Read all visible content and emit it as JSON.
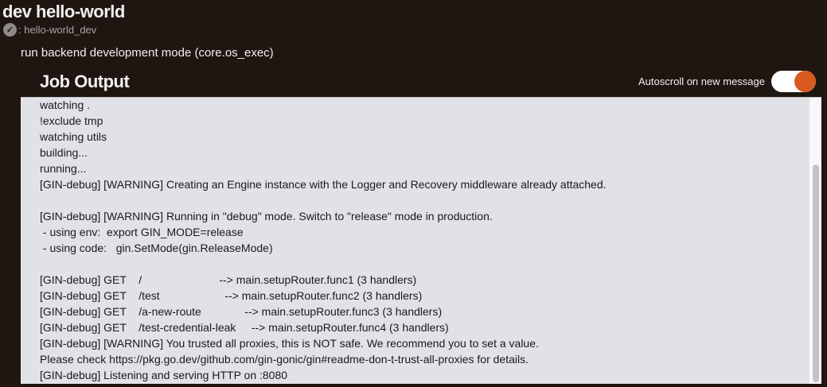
{
  "header": {
    "title": "dev hello-world",
    "environment": ": hello-world_dev",
    "status_icon": "check-circle-icon"
  },
  "job": {
    "description": "run backend development mode (core.os_exec)"
  },
  "output": {
    "title": "Job Output",
    "autoscroll_label": "Autoscroll on new message",
    "autoscroll_enabled": true,
    "lines": [
      "watching .",
      "!exclude tmp",
      "watching utils",
      "building...",
      "running...",
      "[GIN-debug] [WARNING] Creating an Engine instance with the Logger and Recovery middleware already attached.",
      "",
      "[GIN-debug] [WARNING] Running in \"debug\" mode. Switch to \"release\" mode in production.",
      " - using env:  export GIN_MODE=release",
      " - using code:   gin.SetMode(gin.ReleaseMode)",
      "",
      "[GIN-debug] GET    /                         --> main.setupRouter.func1 (3 handlers)",
      "[GIN-debug] GET    /test                     --> main.setupRouter.func2 (3 handlers)",
      "[GIN-debug] GET    /a-new-route              --> main.setupRouter.func3 (3 handlers)",
      "[GIN-debug] GET    /test-credential-leak     --> main.setupRouter.func4 (3 handlers)",
      "[GIN-debug] [WARNING] You trusted all proxies, this is NOT safe. We recommend you to set a value.",
      "Please check https://pkg.go.dev/github.com/gin-gonic/gin#readme-don-t-trust-all-proxies for details.",
      "[GIN-debug] Listening and serving HTTP on :8080"
    ]
  },
  "colors": {
    "background": "#1f1612",
    "accent": "#d85a20",
    "panel": "#e1e2e7"
  }
}
